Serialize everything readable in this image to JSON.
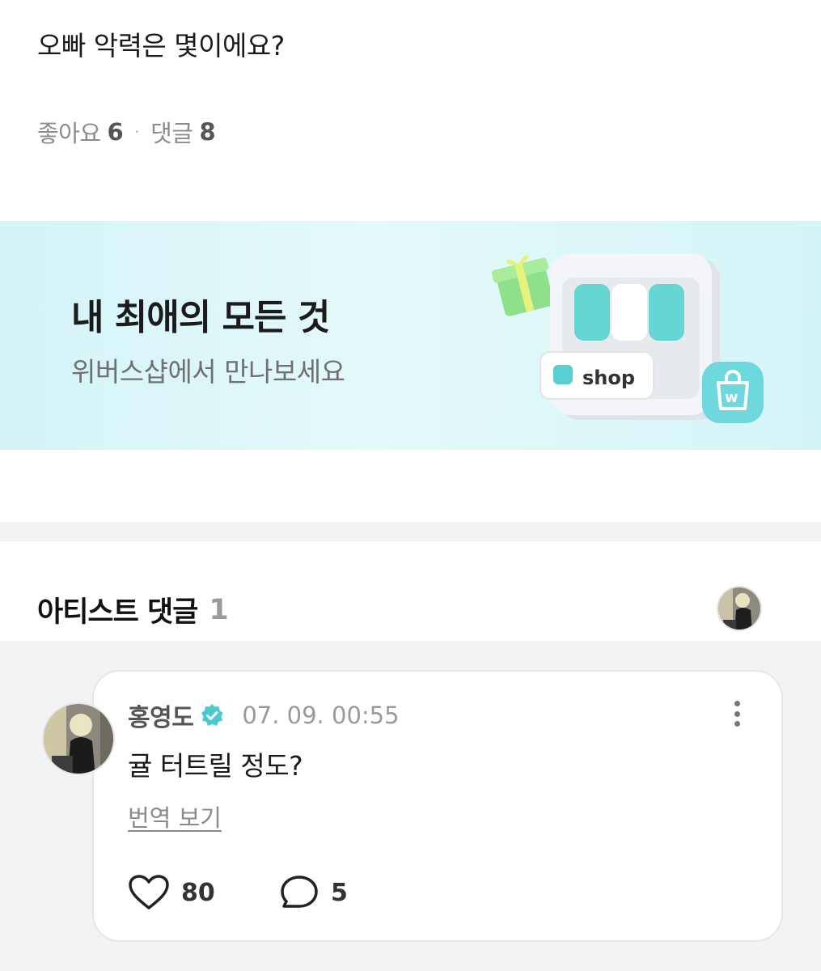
{
  "post": {
    "text": "오빠 악력은 몇이에요?",
    "likes_label": "좋아요",
    "likes_count": "6",
    "separator": "·",
    "comments_label": "댓글",
    "comments_count": "8"
  },
  "banner": {
    "title": "내 최애의 모든 것",
    "subtitle": "위버스샵에서 만나보세요",
    "shop_label": "shop",
    "bag_letter": "w",
    "colors": {
      "background": "#d4f4f8",
      "accent": "#5fd3d0"
    }
  },
  "artist_comments": {
    "title": "아티스트 댓글",
    "count": "1"
  },
  "comment": {
    "author": "홍영도",
    "verified_icon": "verified-check-icon",
    "timestamp": "07. 09. 00:55",
    "body": "귤 터트릴 정도?",
    "translate": "번역 보기",
    "likes": "80",
    "replies": "5",
    "icons": {
      "like": "heart-icon",
      "reply": "speech-bubble-icon",
      "more": "more-vertical-icon"
    }
  }
}
